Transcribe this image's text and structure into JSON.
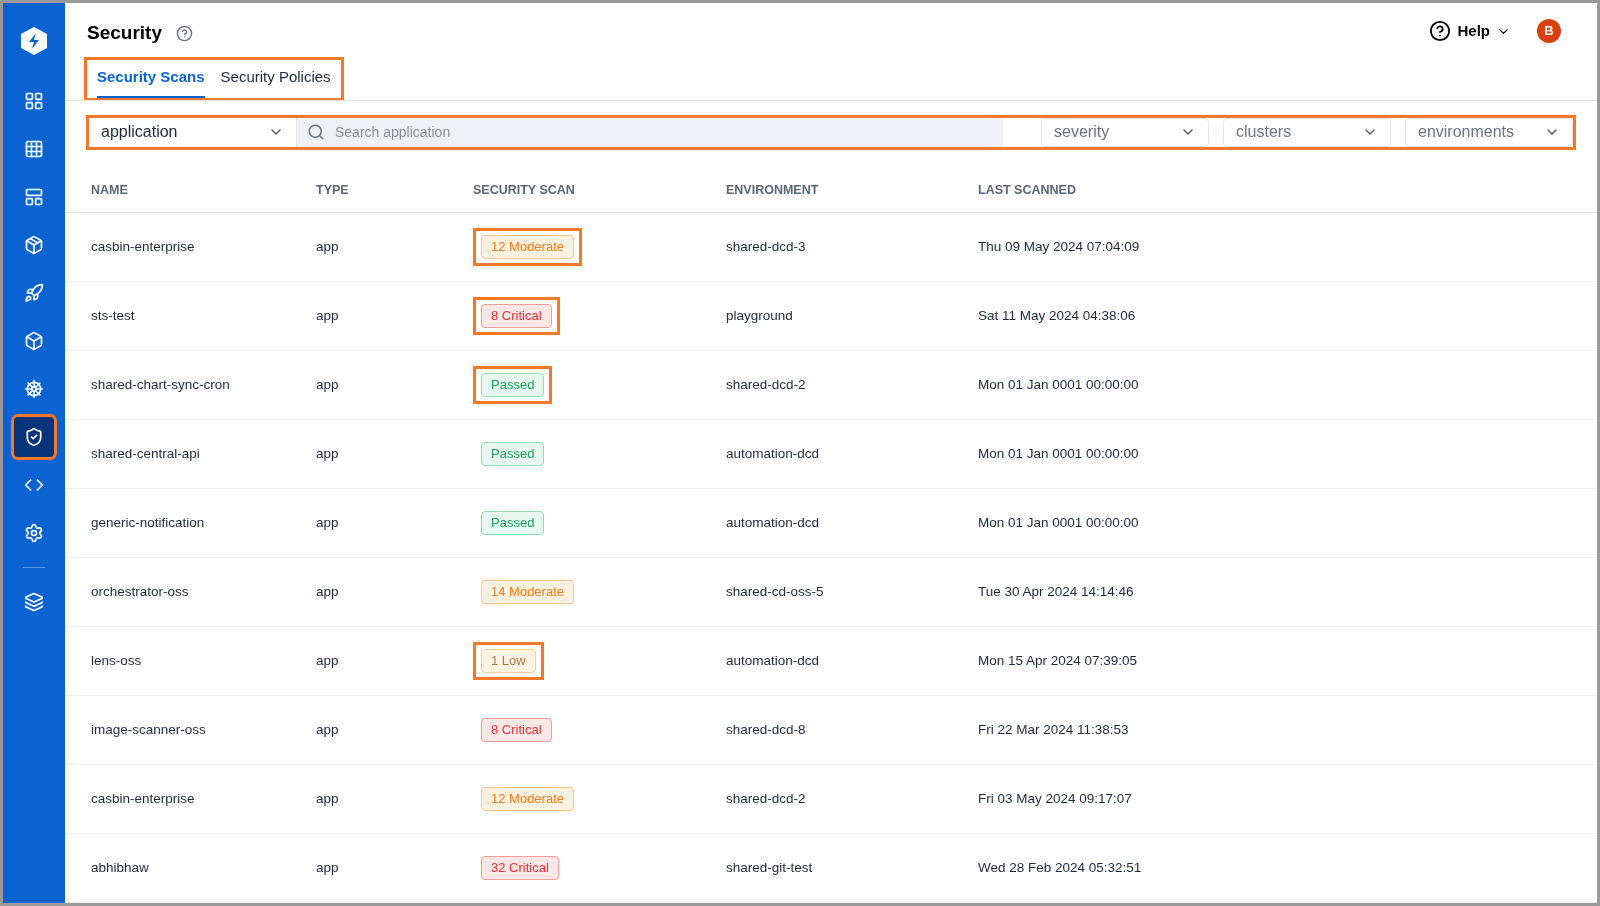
{
  "sidebar": {
    "items": [
      {
        "kind": "link",
        "selected": false,
        "highlighted": false
      },
      {
        "kind": "link",
        "selected": false,
        "highlighted": false
      },
      {
        "kind": "link",
        "selected": false,
        "highlighted": false
      },
      {
        "kind": "link",
        "selected": false,
        "highlighted": false
      },
      {
        "kind": "link",
        "selected": false,
        "highlighted": false
      },
      {
        "kind": "link",
        "selected": false,
        "highlighted": false
      },
      {
        "kind": "link",
        "selected": false,
        "highlighted": false
      },
      {
        "kind": "link",
        "selected": true,
        "highlighted": true
      },
      {
        "kind": "link",
        "selected": false,
        "highlighted": false
      },
      {
        "kind": "link",
        "selected": false,
        "highlighted": false
      },
      {
        "kind": "divider"
      },
      {
        "kind": "link",
        "selected": false,
        "highlighted": false
      }
    ]
  },
  "header": {
    "title": "Security",
    "help": "Help",
    "avatar": "B"
  },
  "tabs": {
    "highlighted": true,
    "items": [
      {
        "label": "Security Scans",
        "selected": true
      },
      {
        "label": "Security Policies",
        "selected": false
      }
    ]
  },
  "filters": {
    "highlighted": true,
    "scope": "application",
    "search": {
      "placeholder": "Search application"
    },
    "dropdowns": [
      "severity",
      "clusters",
      "environments"
    ]
  },
  "table": {
    "columns": [
      "NAME",
      "TYPE",
      "SECURITY SCAN",
      "ENVIRONMENT",
      "LAST SCANNED"
    ],
    "rows": [
      {
        "name": "casbin-enterprise",
        "type": "app",
        "scan": "12 Moderate",
        "kind": "moderate",
        "highlighted": true,
        "environment": "shared-dcd-3",
        "last_scanned": "Thu 09 May 2024 07:04:09"
      },
      {
        "name": "sts-test",
        "type": "app",
        "scan": "8 Critical",
        "kind": "critical",
        "highlighted": true,
        "environment": "playground",
        "last_scanned": "Sat 11 May 2024 04:38:06"
      },
      {
        "name": "shared-chart-sync-cron",
        "type": "app",
        "scan": "Passed",
        "kind": "passed",
        "highlighted": true,
        "environment": "shared-dcd-2",
        "last_scanned": "Mon 01 Jan 0001 00:00:00"
      },
      {
        "name": "shared-central-api",
        "type": "app",
        "scan": "Passed",
        "kind": "passed",
        "highlighted": false,
        "environment": "automation-dcd",
        "last_scanned": "Mon 01 Jan 0001 00:00:00"
      },
      {
        "name": "generic-notification",
        "type": "app",
        "scan": "Passed",
        "kind": "passed",
        "highlighted": false,
        "environment": "automation-dcd",
        "last_scanned": "Mon 01 Jan 0001 00:00:00"
      },
      {
        "name": "orchestrator-oss",
        "type": "app",
        "scan": "14 Moderate",
        "kind": "moderate",
        "highlighted": false,
        "environment": "shared-cd-oss-5",
        "last_scanned": "Tue 30 Apr 2024 14:14:46"
      },
      {
        "name": "lens-oss",
        "type": "app",
        "scan": "1 Low",
        "kind": "low",
        "highlighted": true,
        "environment": "automation-dcd",
        "last_scanned": "Mon 15 Apr 2024 07:39:05"
      },
      {
        "name": "image-scanner-oss",
        "type": "app",
        "scan": "8 Critical",
        "kind": "critical",
        "highlighted": false,
        "environment": "shared-dcd-8",
        "last_scanned": "Fri 22 Mar 2024 11:38:53"
      },
      {
        "name": "casbin-enterprise",
        "type": "app",
        "scan": "12 Moderate",
        "kind": "moderate",
        "highlighted": false,
        "environment": "shared-dcd-2",
        "last_scanned": "Fri 03 May 2024 09:17:07"
      },
      {
        "name": "abhibhaw",
        "type": "app",
        "scan": "32 Critical",
        "kind": "critical",
        "highlighted": false,
        "environment": "shared-git-test",
        "last_scanned": "Wed 28 Feb 2024 05:32:51"
      }
    ]
  }
}
